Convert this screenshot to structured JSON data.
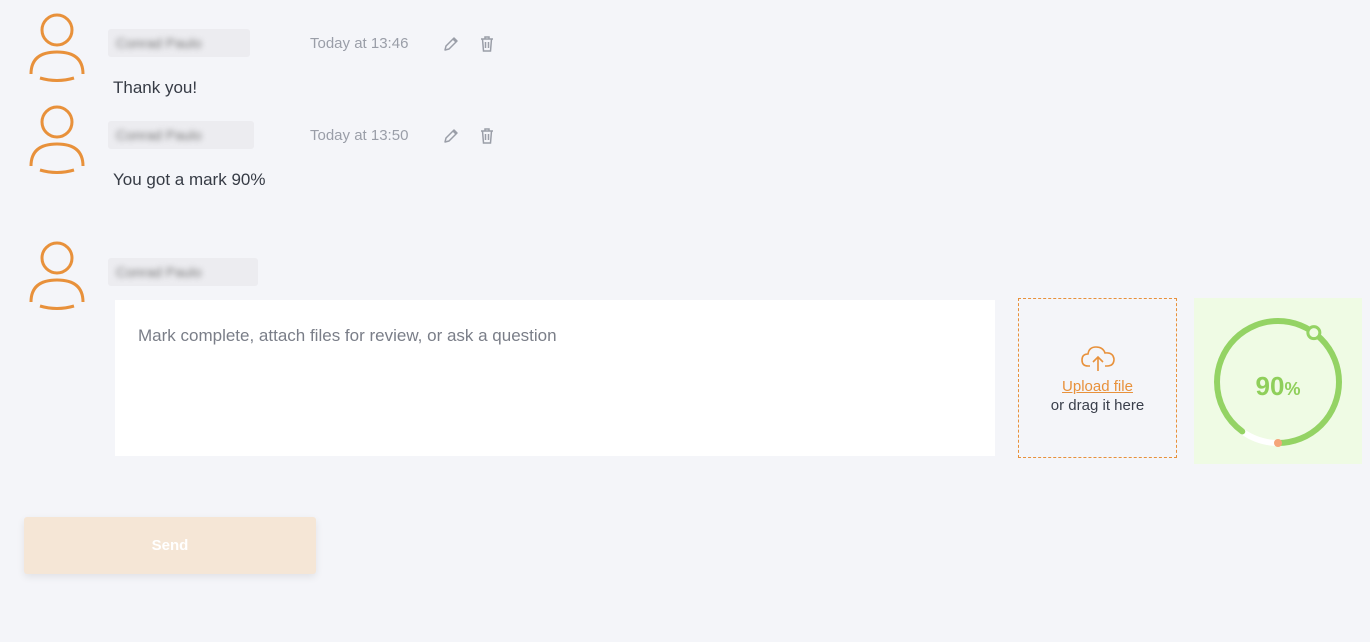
{
  "colors": {
    "accent": "#e8913b",
    "success": "#8fcf5a",
    "background": "#f4f5f9"
  },
  "messages": [
    {
      "author": "Conrad Paulo",
      "timestamp": "Today at 13:46",
      "text": "Thank you!"
    },
    {
      "author": "Conrad Paulo",
      "timestamp": "Today at 13:50",
      "text": "You got a mark 90%"
    }
  ],
  "composer": {
    "author": "Conrad Paulo",
    "placeholder": "Mark complete, attach files for review, or ask a question",
    "value": ""
  },
  "upload": {
    "link_label": "Upload file",
    "hint": "or drag it here",
    "icon": "cloud-upload-icon"
  },
  "progress": {
    "value": 0.9,
    "number": "90",
    "unit": "%"
  },
  "send_label": "Send",
  "icons": {
    "edit": "pencil-icon",
    "delete": "trash-icon",
    "avatar": "user-avatar-icon"
  }
}
